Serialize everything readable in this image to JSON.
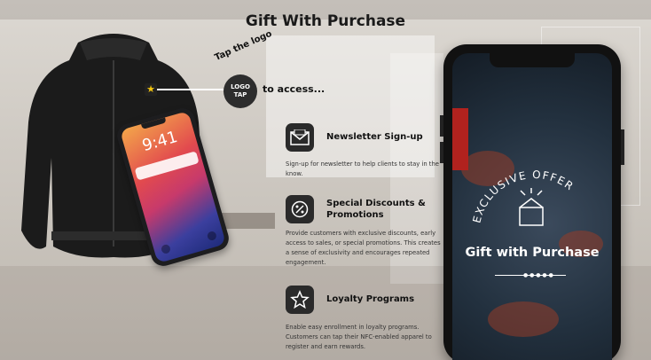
{
  "header": {
    "title": "Gift With Purchase"
  },
  "tap": {
    "curved_text": "Tap the logo",
    "logo_line1": "LOGO",
    "logo_line2": "TAP",
    "access_text": "to access..."
  },
  "small_phone": {
    "time": "9:41"
  },
  "features": [
    {
      "icon": "newsletter-icon",
      "title": "Newsletter Sign-up",
      "desc": "Sign-up for newsletter to help clients to stay in the know."
    },
    {
      "icon": "discount-icon",
      "title": "Special Discounts & Promotions",
      "desc": "Provide customers with exclusive discounts, early access to sales, or special promotions. This creates a sense of exclusivity and encourages repeated engagement."
    },
    {
      "icon": "star-icon",
      "title": "Loyalty Programs",
      "desc": "Enable easy enrollment in loyalty programs. Customers can tap their NFC-enabled apparel to register and earn rewards."
    }
  ],
  "big_phone": {
    "arc_text": "EXCLUSIVE OFFER",
    "headline": "Gift with Purchase"
  },
  "colors": {
    "icon_bg": "#2a2a2a",
    "phone_screen": "#22303e",
    "star": "#f2c40f"
  }
}
